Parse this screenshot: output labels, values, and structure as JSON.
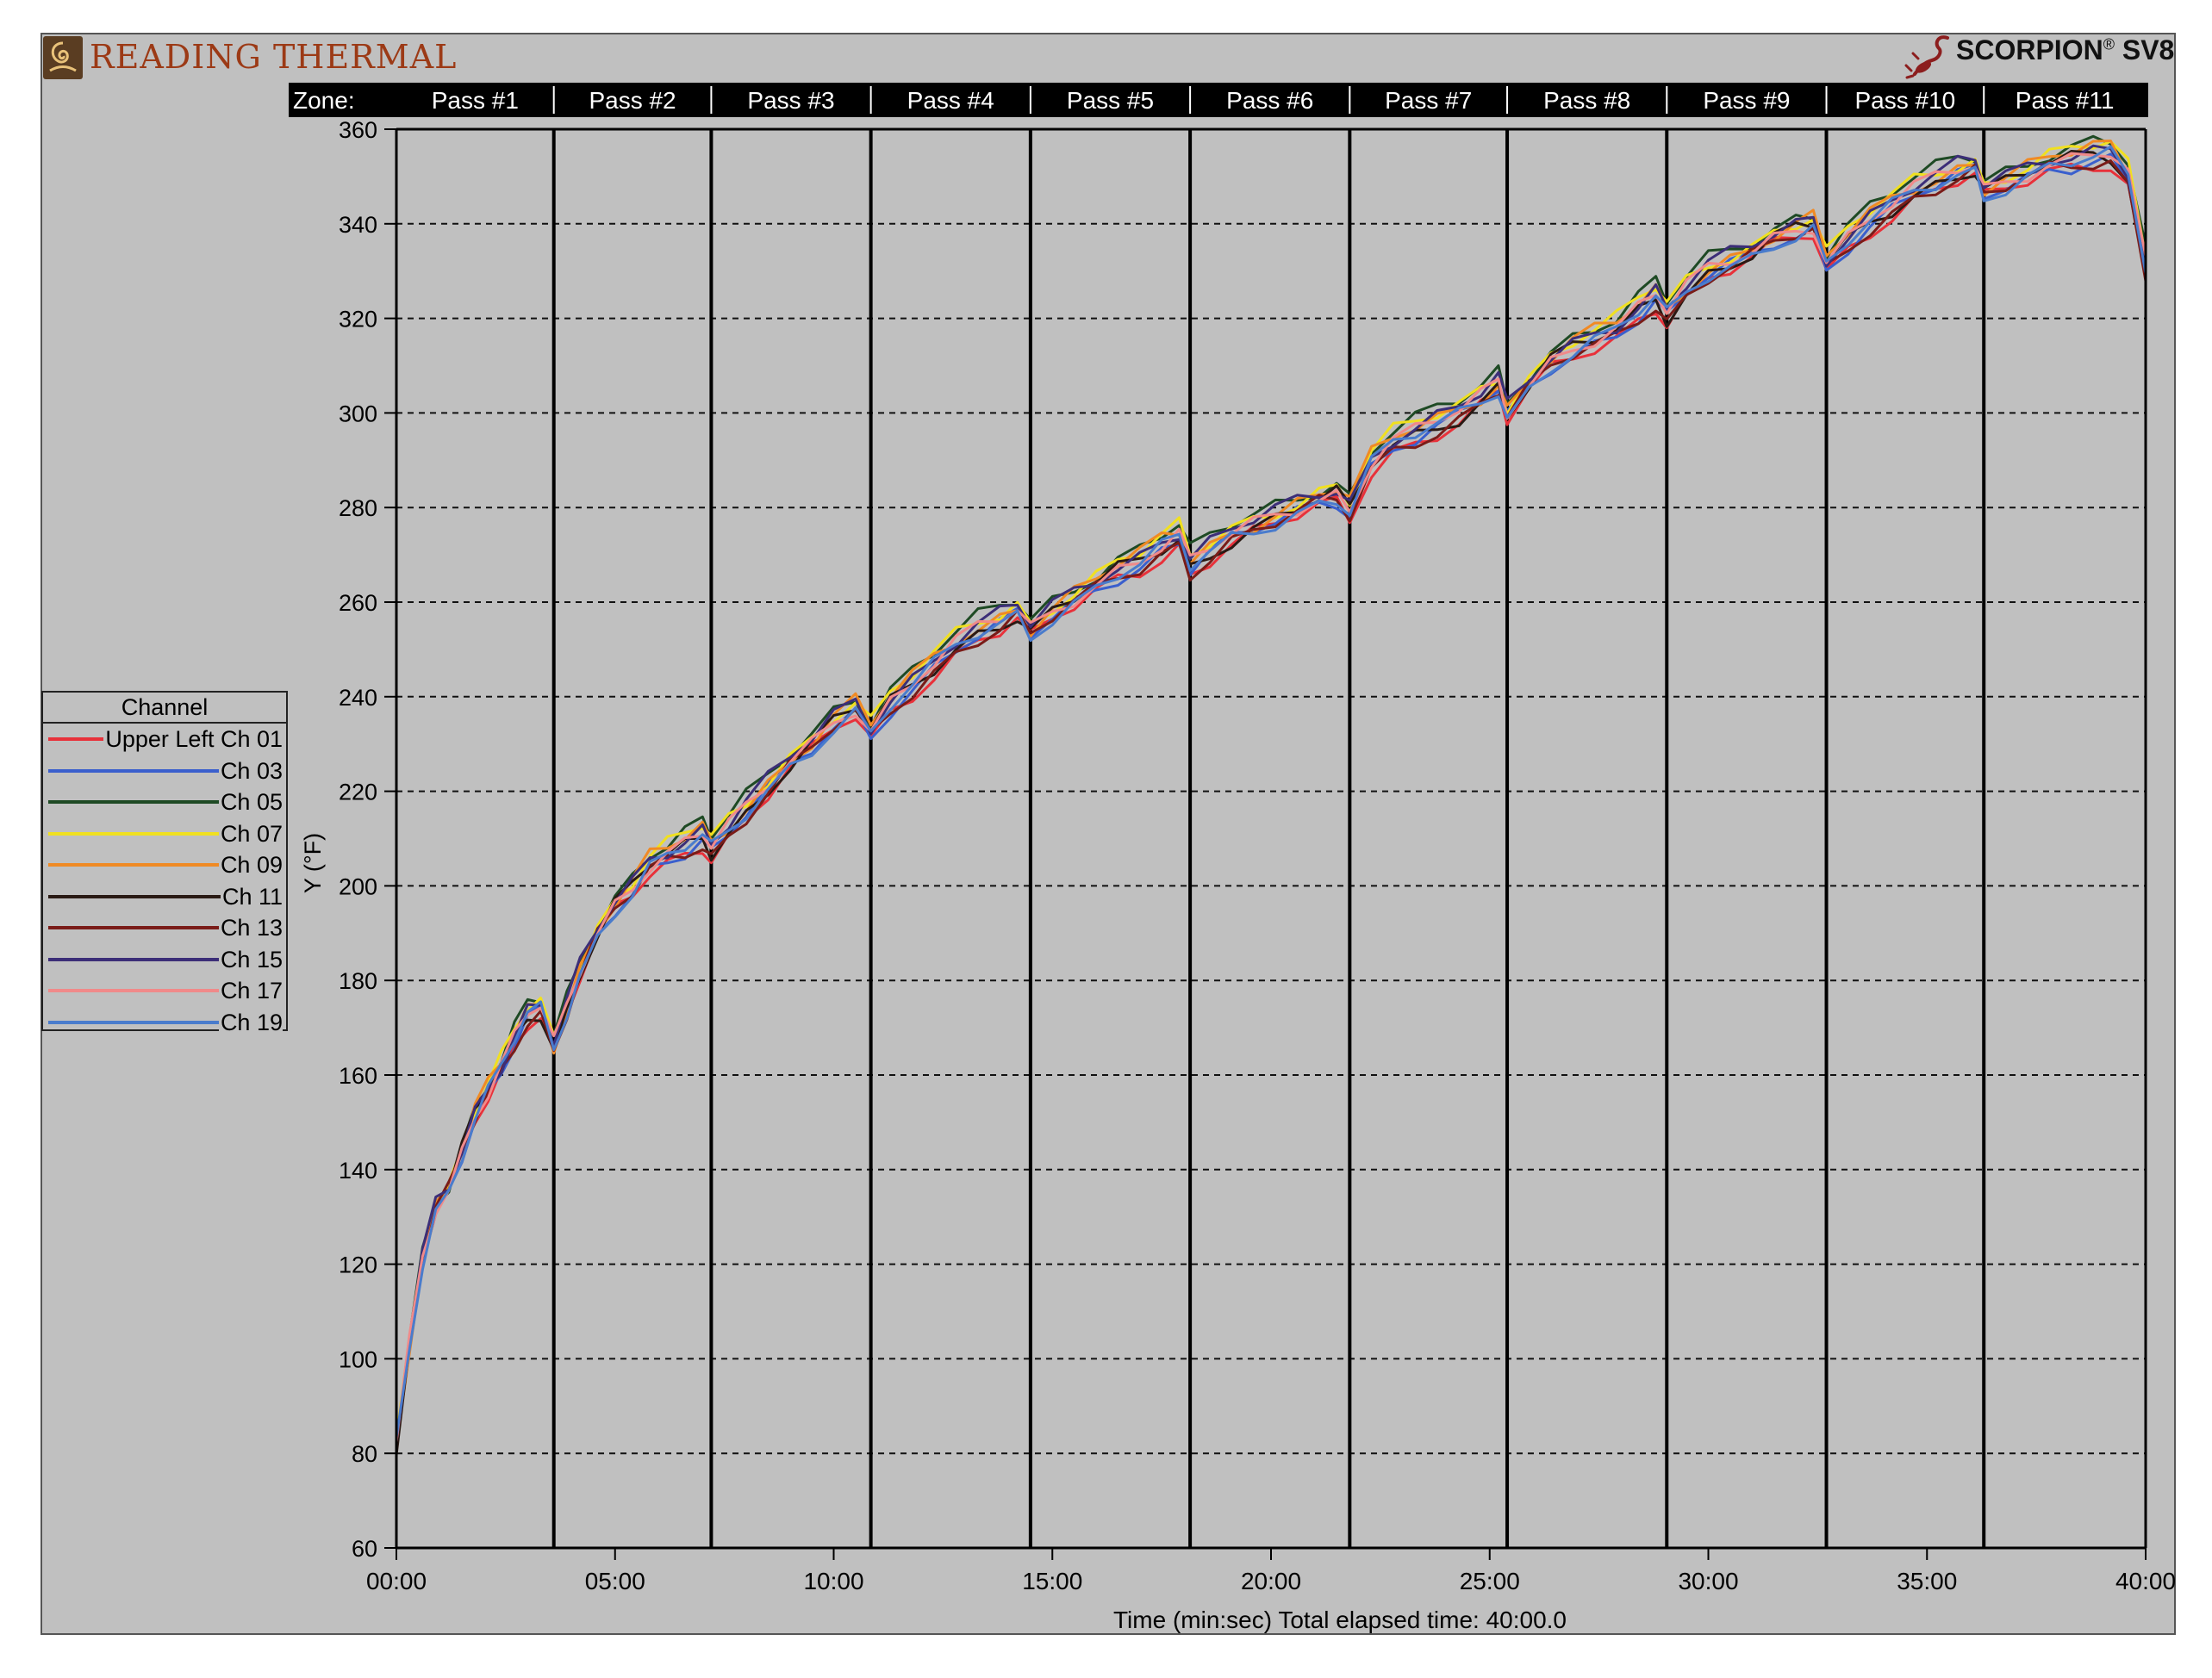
{
  "header": {
    "brand": "READING THERMAL",
    "logo_icon": "reading-thermal-logo-icon",
    "product": "SCORPION",
    "product_mark": "®",
    "product_model": "SV8",
    "product_icon": "scorpion-icon"
  },
  "legend": {
    "title": "Channel"
  },
  "chart_data": {
    "type": "line",
    "title": "",
    "xlabel": "Time (min:sec) Total elapsed time: 40:00.0",
    "ylabel": "Y (°F)",
    "x_unit": "minutes",
    "xlim": [
      0,
      40
    ],
    "ylim": [
      60,
      360
    ],
    "x_ticks": [
      0,
      5,
      10,
      15,
      20,
      25,
      30,
      35,
      40
    ],
    "x_tick_labels": [
      "00:00",
      "05:00",
      "10:00",
      "15:00",
      "20:00",
      "25:00",
      "30:00",
      "35:00",
      "40:00"
    ],
    "y_ticks": [
      60,
      80,
      100,
      120,
      140,
      160,
      180,
      200,
      220,
      240,
      260,
      280,
      300,
      320,
      340,
      360
    ],
    "grid": "horizontal dashed",
    "legend_position": "left",
    "background": "#c0c0c0",
    "zones": {
      "label": "Zone:",
      "boundaries": [
        0,
        3.6,
        7.2,
        10.85,
        14.5,
        18.15,
        21.8,
        25.4,
        29.05,
        32.7,
        36.3,
        40
      ],
      "names": [
        "Pass #1",
        "Pass #2",
        "Pass #3",
        "Pass #4",
        "Pass #5",
        "Pass #6",
        "Pass #7",
        "Pass #8",
        "Pass #9",
        "Pass #10",
        "Pass #11"
      ]
    },
    "x": [
      0,
      0.3,
      0.6,
      0.9,
      1.2,
      1.5,
      1.8,
      2.1,
      2.4,
      2.7,
      3.0,
      3.3,
      3.6,
      3.9,
      4.2,
      4.6,
      5.0,
      5.4,
      5.8,
      6.2,
      6.6,
      7.0,
      7.2,
      7.6,
      8.0,
      8.5,
      9.0,
      9.5,
      10.0,
      10.5,
      10.85,
      11.3,
      11.8,
      12.3,
      12.8,
      13.3,
      13.8,
      14.2,
      14.5,
      15.0,
      15.5,
      16.0,
      16.5,
      17.0,
      17.5,
      17.9,
      18.15,
      18.6,
      19.1,
      19.6,
      20.1,
      20.6,
      21.1,
      21.5,
      21.8,
      22.3,
      22.8,
      23.3,
      23.8,
      24.3,
      24.8,
      25.2,
      25.4,
      25.9,
      26.4,
      26.9,
      27.4,
      27.9,
      28.4,
      28.8,
      29.05,
      29.5,
      30.0,
      30.5,
      31.0,
      31.5,
      32.0,
      32.4,
      32.7,
      33.2,
      33.7,
      34.2,
      34.7,
      35.2,
      35.7,
      36.1,
      36.3,
      36.8,
      37.3,
      37.8,
      38.3,
      38.8,
      39.2,
      39.6,
      40.0
    ],
    "base": [
      82,
      103,
      121,
      132,
      136,
      144,
      152,
      157,
      162,
      168,
      173,
      174,
      166,
      174,
      182,
      190,
      196,
      200,
      205,
      207,
      209,
      211,
      208,
      212,
      216,
      221,
      226,
      230,
      235,
      238,
      233,
      239,
      243,
      247,
      251,
      254,
      256,
      258,
      254,
      258,
      261,
      264,
      267,
      269,
      272,
      274,
      268,
      271,
      274,
      276,
      278,
      280,
      282,
      283,
      280,
      290,
      294,
      296,
      298,
      300,
      303,
      306,
      300,
      306,
      311,
      314,
      316,
      318,
      322,
      325,
      321,
      326,
      330,
      332,
      334,
      337,
      339,
      340,
      332,
      337,
      341,
      344,
      347,
      349,
      351,
      352,
      347,
      349,
      351,
      353,
      354,
      355,
      355,
      350,
      331
    ],
    "series": [
      {
        "name": "Upper Left Ch 01",
        "color": "#e8313a",
        "offset": -2.0
      },
      {
        "name": "Ch 03",
        "color": "#3a5fcd",
        "offset": -1.2
      },
      {
        "name": "Ch 05",
        "color": "#1e4a24",
        "offset": 2.4
      },
      {
        "name": "Ch 07",
        "color": "#f0e020",
        "offset": 1.6
      },
      {
        "name": "Ch 09",
        "color": "#f08a24",
        "offset": 0.9
      },
      {
        "name": "Ch 11",
        "color": "#2a1a14",
        "offset": -0.5
      },
      {
        "name": "Ch 13",
        "color": "#7a1c18",
        "offset": -1.5
      },
      {
        "name": "Ch 15",
        "color": "#3c2e78",
        "offset": 1.1
      },
      {
        "name": "Ch 17",
        "color": "#f08a8a",
        "offset": 0.2
      },
      {
        "name": "Ch 19",
        "color": "#4a7ccc",
        "offset": -0.8
      }
    ]
  }
}
